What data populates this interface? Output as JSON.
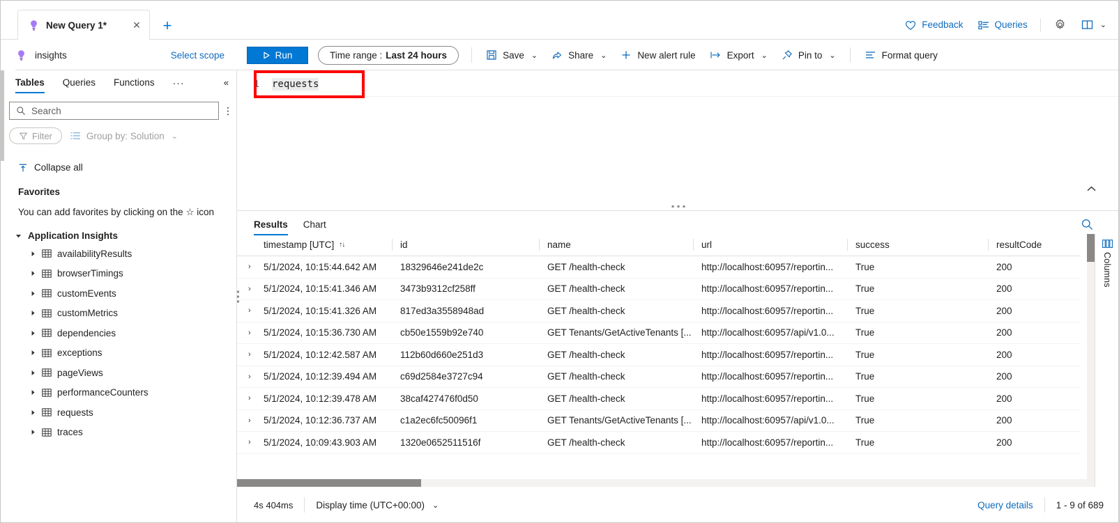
{
  "tabstrip": {
    "tab_label": "New Query 1*",
    "tab_icon": "app-insights-icon",
    "close_label": "✕",
    "add_label": "+",
    "actions": [
      {
        "label": "Feedback",
        "icon": "heart-icon"
      },
      {
        "label": "Queries",
        "icon": "queries-list-icon"
      }
    ],
    "settings_icon": "gear-icon",
    "help_icon": "book-icon",
    "help_chevron": "⌄"
  },
  "commandbar": {
    "scope_name": "insights",
    "scope_icon": "app-insights-icon",
    "select_scope_label": "Select scope",
    "run_label": "Run",
    "run_icon": "play-icon",
    "time_range_prefix": "Time range :",
    "time_range_value": "Last 24 hours",
    "items": [
      {
        "label": "Save",
        "icon": "save-icon",
        "chevron": "⌄"
      },
      {
        "label": "Share",
        "icon": "share-icon",
        "chevron": "⌄"
      },
      {
        "label": "New alert rule",
        "icon": "plus-icon",
        "chevron": ""
      },
      {
        "label": "Export",
        "icon": "export-icon",
        "chevron": "⌄"
      },
      {
        "label": "Pin to",
        "icon": "pin-icon",
        "chevron": "⌄"
      },
      {
        "label": "Format query",
        "icon": "format-icon",
        "chevron": ""
      }
    ]
  },
  "sidebar": {
    "tabs": [
      {
        "label": "Tables",
        "active": true
      },
      {
        "label": "Queries",
        "active": false
      },
      {
        "label": "Functions",
        "active": false
      }
    ],
    "overflow_label": "···",
    "collapse_label": "«",
    "search": {
      "placeholder": "Search",
      "value": "",
      "icon": "search-icon"
    },
    "search_more_label": "⋮",
    "filter_label": "Filter",
    "filter_icon": "filter-icon",
    "group_by_label": "Group by: Solution",
    "group_by_icon": "list-icon",
    "group_by_chevron": "⌄",
    "collapse_all_label": "Collapse all",
    "collapse_all_icon": "collapse-all-icon",
    "favorites_title": "Favorites",
    "favorites_hint": "You can add favorites by clicking on the ☆ icon",
    "group_title": "Application Insights",
    "tables": [
      "availabilityResults",
      "browserTimings",
      "customEvents",
      "customMetrics",
      "dependencies",
      "exceptions",
      "pageViews",
      "performanceCounters",
      "requests",
      "traces"
    ]
  },
  "editor": {
    "line_number": "1",
    "query_text": "requests",
    "highlight_color": "#fe0000",
    "collapse_icon": "⌃"
  },
  "results": {
    "tabs": [
      {
        "label": "Results",
        "active": true
      },
      {
        "label": "Chart",
        "active": false
      }
    ],
    "search_icon": "search-icon",
    "columns": [
      "timestamp [UTC]",
      "id",
      "name",
      "url",
      "success",
      "resultCode"
    ],
    "sort_column": "timestamp [UTC]",
    "sort_icon": "↑↓",
    "rows": [
      {
        "timestamp": "5/1/2024, 10:15:44.642 AM",
        "id": "18329646e241de2c",
        "name": "GET /health-check",
        "url": "http://localhost:60957/reportin...",
        "success": "True",
        "resultCode": "200"
      },
      {
        "timestamp": "5/1/2024, 10:15:41.346 AM",
        "id": "3473b9312cf258ff",
        "name": "GET /health-check",
        "url": "http://localhost:60957/reportin...",
        "success": "True",
        "resultCode": "200"
      },
      {
        "timestamp": "5/1/2024, 10:15:41.326 AM",
        "id": "817ed3a3558948ad",
        "name": "GET /health-check",
        "url": "http://localhost:60957/reportin...",
        "success": "True",
        "resultCode": "200"
      },
      {
        "timestamp": "5/1/2024, 10:15:36.730 AM",
        "id": "cb50e1559b92e740",
        "name": "GET Tenants/GetActiveTenants [...",
        "url": "http://localhost:60957/api/v1.0...",
        "success": "True",
        "resultCode": "200"
      },
      {
        "timestamp": "5/1/2024, 10:12:42.587 AM",
        "id": "112b60d660e251d3",
        "name": "GET /health-check",
        "url": "http://localhost:60957/reportin...",
        "success": "True",
        "resultCode": "200"
      },
      {
        "timestamp": "5/1/2024, 10:12:39.494 AM",
        "id": "c69d2584e3727c94",
        "name": "GET /health-check",
        "url": "http://localhost:60957/reportin...",
        "success": "True",
        "resultCode": "200"
      },
      {
        "timestamp": "5/1/2024, 10:12:39.478 AM",
        "id": "38caf427476f0d50",
        "name": "GET /health-check",
        "url": "http://localhost:60957/reportin...",
        "success": "True",
        "resultCode": "200"
      },
      {
        "timestamp": "5/1/2024, 10:12:36.737 AM",
        "id": "c1a2ec6fc50096f1",
        "name": "GET Tenants/GetActiveTenants [...",
        "url": "http://localhost:60957/api/v1.0...",
        "success": "True",
        "resultCode": "200"
      },
      {
        "timestamp": "5/1/2024, 10:09:43.903 AM",
        "id": "1320e0652511516f",
        "name": "GET /health-check",
        "url": "http://localhost:60957/reportin...",
        "success": "True",
        "resultCode": "200"
      }
    ],
    "row_expand_icon": "›",
    "columns_pane_label": "Columns",
    "columns_pane_icon": "columns-icon"
  },
  "footer": {
    "duration": "4s 404ms",
    "display_time_label": "Display time (UTC+00:00)",
    "display_time_chevron": "⌄",
    "query_details_label": "Query details",
    "record_range": "1 - 9 of 689"
  }
}
